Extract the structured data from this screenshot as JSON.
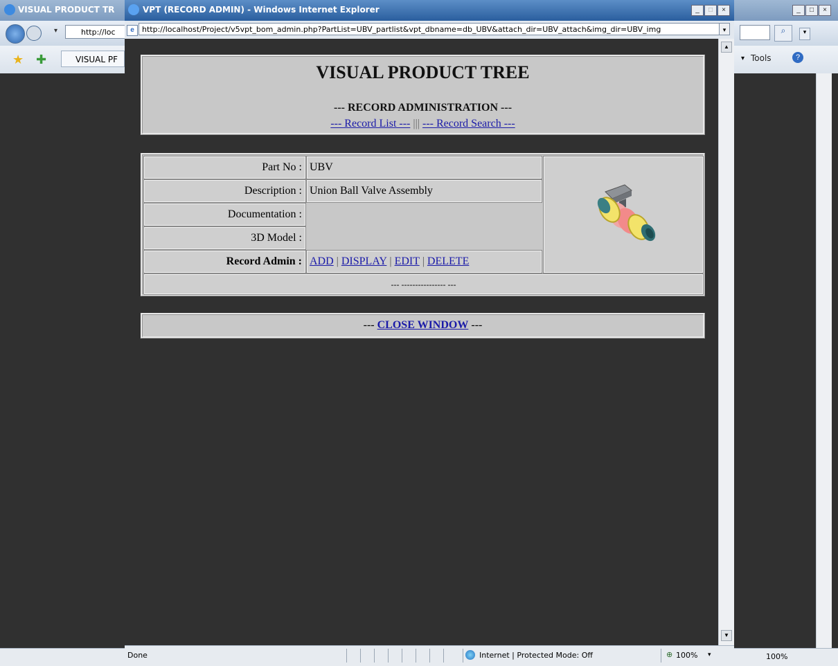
{
  "background_window": {
    "title": "VISUAL PRODUCT TR",
    "address_partial": "http://loc",
    "tab_label": "VISUAL PF",
    "tools_label": "Tools",
    "zoom": "100%"
  },
  "popup": {
    "title": "VPT (RECORD ADMIN) - Windows Internet Explorer",
    "url": "http://localhost/Project/v5vpt_bom_admin.php?PartList=UBV_partlist&vpt_dbname=db_UBV&attach_dir=UBV_attach&img_dir=UBV_img",
    "status_text": "Done",
    "zone_text": "Internet | Protected Mode: Off",
    "zoom": "100%"
  },
  "header": {
    "title": "VISUAL PRODUCT TREE",
    "subtitle": "--- RECORD ADMINISTRATION ---",
    "record_list_link": "--- Record List ---",
    "separator": "|||",
    "record_search_link": "--- Record Search ---"
  },
  "record": {
    "part_no_label": "Part No :",
    "part_no": "UBV",
    "description_label": "Description :",
    "description": "Union Ball Valve Assembly",
    "documentation_label": "Documentation :",
    "model_label": "3D Model :",
    "admin_label": "Record Admin :",
    "actions": {
      "add": "ADD",
      "display": "DISPLAY",
      "edit": "EDIT",
      "delete": "DELETE",
      "sep": "|"
    },
    "footer_text": "--- ---------------- ---"
  },
  "close": {
    "prefix": "---",
    "label": "CLOSE WINDOW",
    "suffix": "---"
  },
  "colors": {
    "panel": "#c8c8c8",
    "link": "#1a1aa8",
    "content_bg": "#303030"
  }
}
